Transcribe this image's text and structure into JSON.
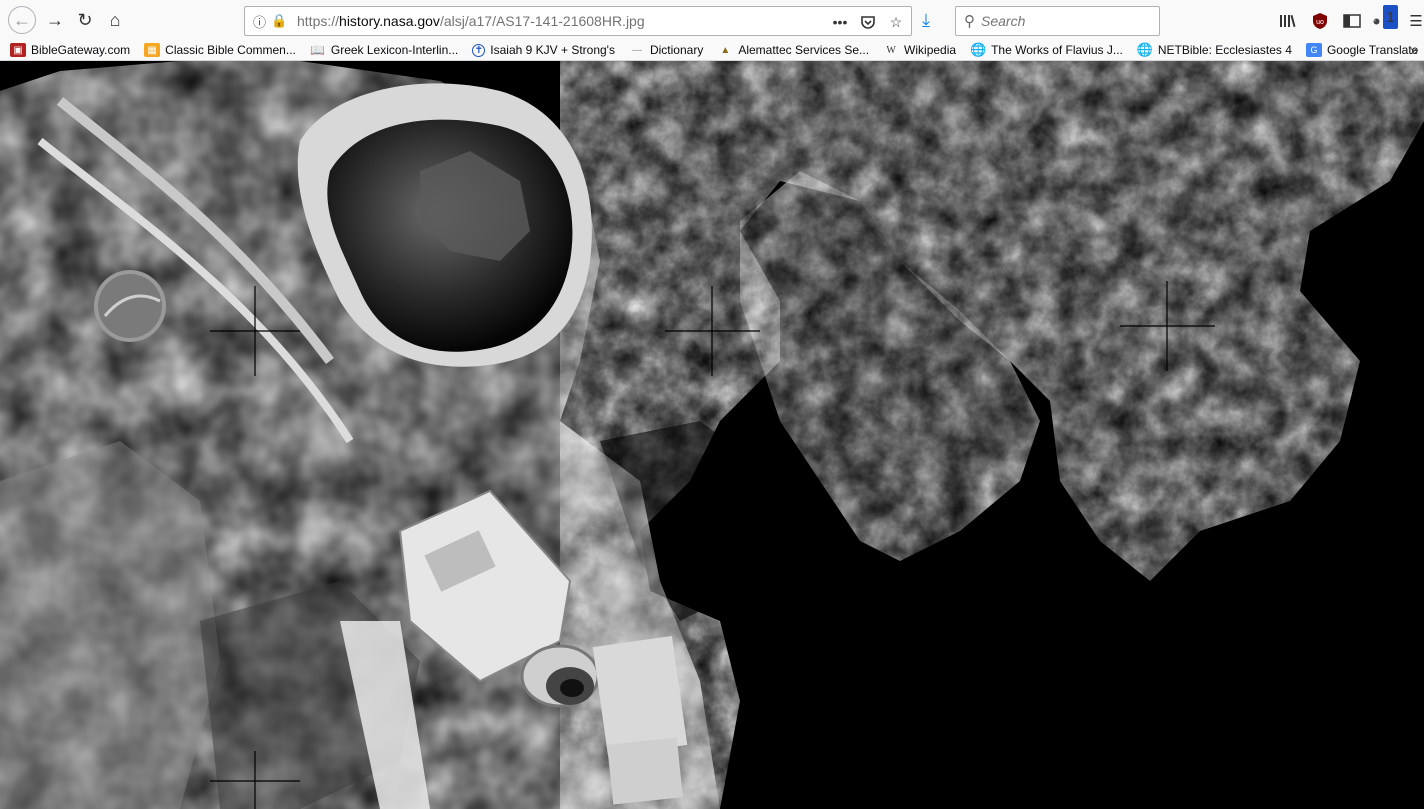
{
  "window": {
    "title": "AS17-141-21608HR.jpg"
  },
  "navigation": {
    "back_icon": "back-arrow-icon",
    "forward_icon": "forward-arrow-icon",
    "reload_icon": "reload-icon",
    "home_icon": "home-icon"
  },
  "urlbar": {
    "prefix": "https://",
    "host": "history.nasa.gov",
    "path": "/alsj/a17/AS17-141-21608HR.jpg",
    "actions": [
      "page-actions-icon",
      "pocket-icon",
      "bookmark-star-icon"
    ]
  },
  "search": {
    "placeholder": "Search"
  },
  "toolbar": {
    "icons": [
      "library-icon",
      "ublock-icon",
      "sidebar-icon",
      "extension-icon",
      "menu-icon"
    ],
    "extension_badge": "1"
  },
  "bookmarks": [
    {
      "label": "BibleGateway.com",
      "icon": "biblegateway-icon",
      "color": "#b22222"
    },
    {
      "label": "Classic Bible Commen...",
      "icon": "classic-bible-icon",
      "color": "#f5a623"
    },
    {
      "label": "Greek Lexicon-Interlin...",
      "icon": "book-icon",
      "color": "#666666"
    },
    {
      "label": "Isaiah 9 KJV + Strong's",
      "icon": "cross-icon",
      "color": "#1b50c7"
    },
    {
      "label": "Dictionary",
      "icon": "dictionary-icon",
      "color": "#999999"
    },
    {
      "label": "Alemattec Services Se...",
      "icon": "alemattec-icon",
      "color": "#8b6914"
    },
    {
      "label": "Wikipedia",
      "icon": "wikipedia-icon",
      "color": "#333333"
    },
    {
      "label": "The Works of Flavius J...",
      "icon": "globe-icon",
      "color": "#555555"
    },
    {
      "label": "NETBible: Ecclesiastes 4",
      "icon": "globe-icon",
      "color": "#555555"
    },
    {
      "label": "Google Translate",
      "icon": "translate-icon",
      "color": "#4285f4"
    }
  ],
  "content": {
    "image_alt": "AS17-141-21608HR"
  }
}
